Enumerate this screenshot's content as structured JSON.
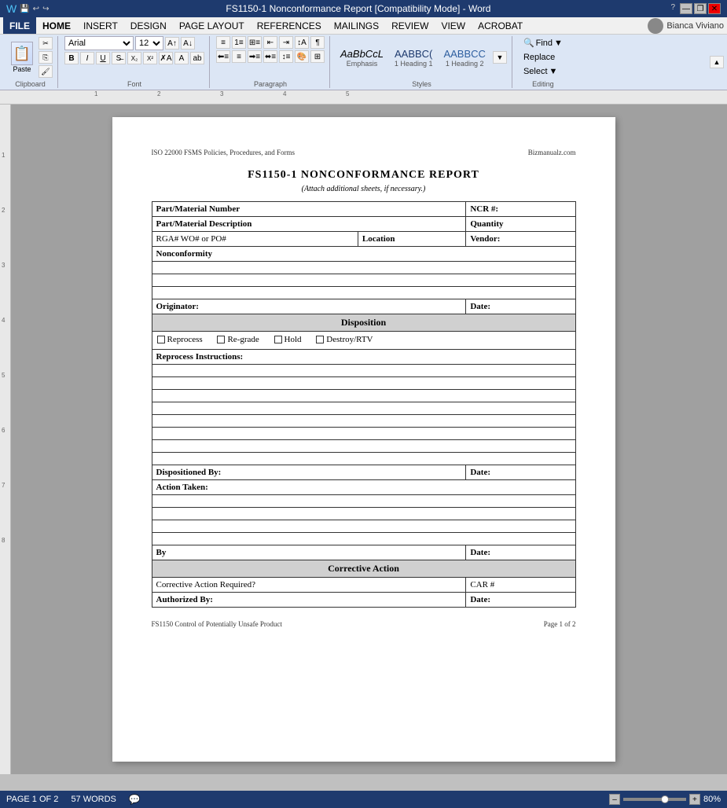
{
  "titleBar": {
    "title": "FS1150-1 Nonconformance Report [Compatibility Mode] - Word",
    "helpBtn": "?",
    "minimizeBtn": "—",
    "restoreBtn": "❐",
    "closeBtn": "✕"
  },
  "menuBar": {
    "fileLabel": "FILE",
    "tabs": [
      "HOME",
      "INSERT",
      "DESIGN",
      "PAGE LAYOUT",
      "REFERENCES",
      "MAILINGS",
      "REVIEW",
      "VIEW",
      "ACROBAT"
    ],
    "activeTab": "HOME",
    "user": "Bianca Viviano"
  },
  "ribbon": {
    "clipboard": {
      "label": "Clipboard",
      "pasteLabel": "Paste"
    },
    "font": {
      "label": "Font",
      "fontName": "Arial",
      "fontSize": "12",
      "boldLabel": "B",
      "italicLabel": "I",
      "underlineLabel": "U"
    },
    "paragraph": {
      "label": "Paragraph"
    },
    "styles": {
      "label": "Styles",
      "items": [
        {
          "sample": "AaBbCcL",
          "label": "Emphasis"
        },
        {
          "sample": "AABBC(",
          "label": "1 Heading 1"
        },
        {
          "sample": "AABBCC",
          "label": "1 Heading 2"
        }
      ]
    },
    "editing": {
      "label": "Editing",
      "findLabel": "Find",
      "replaceLabel": "Replace",
      "selectLabel": "Select"
    }
  },
  "ruler": {
    "marks": [
      "1",
      "2",
      "3",
      "4",
      "5"
    ]
  },
  "document": {
    "header": {
      "left": "ISO 22000 FSMS Policies, Procedures, and Forms",
      "right": "Bizmanualz.com"
    },
    "formTitle": "FS1150-1   NONCONFORMANCE REPORT",
    "formSubtitle": "(Attach additional sheets, if necessary.)",
    "table": {
      "rows": [
        {
          "type": "header-row",
          "col1": "Part/Material Number",
          "col2": "NCR #:"
        },
        {
          "type": "header-row",
          "col1": "Part/Material Description",
          "col2": "Quantity"
        },
        {
          "type": "data-row",
          "col1a": "RGA# WO# or PO#",
          "col1b": "Location",
          "col2": "Vendor:"
        },
        {
          "type": "full-row",
          "label": "Nonconformity"
        },
        {
          "type": "empty-row"
        },
        {
          "type": "empty-row"
        },
        {
          "type": "empty-row"
        },
        {
          "type": "sig-row",
          "col1": "Originator:",
          "col2": "Date:"
        },
        {
          "type": "section-header",
          "label": "Disposition"
        },
        {
          "type": "checkbox-row",
          "items": [
            "Reprocess",
            "Re-grade",
            "Hold",
            "Destroy/RTV"
          ]
        },
        {
          "type": "full-row",
          "label": "Reprocess Instructions:"
        },
        {
          "type": "empty-row"
        },
        {
          "type": "empty-row"
        },
        {
          "type": "empty-row"
        },
        {
          "type": "empty-row"
        },
        {
          "type": "empty-row"
        },
        {
          "type": "empty-row"
        },
        {
          "type": "empty-row"
        },
        {
          "type": "empty-row"
        },
        {
          "type": "sig-row",
          "col1": "Dispositioned By:",
          "col2": "Date:"
        },
        {
          "type": "full-row",
          "label": "Action Taken:"
        },
        {
          "type": "empty-row"
        },
        {
          "type": "empty-row"
        },
        {
          "type": "empty-row"
        },
        {
          "type": "empty-row"
        },
        {
          "type": "sig-row",
          "col1": "By",
          "col2": "Date:"
        },
        {
          "type": "section-header",
          "label": "Corrective Action"
        },
        {
          "type": "sig-row",
          "col1": "Corrective Action Required?",
          "col2": "CAR #"
        },
        {
          "type": "sig-row",
          "col1": "Authorized By:",
          "col2": "Date:"
        }
      ]
    },
    "footer": {
      "left": "FS1150 Control of Potentially Unsafe Product",
      "right": "Page 1 of 2"
    }
  },
  "statusBar": {
    "pageInfo": "PAGE 1 OF 2",
    "wordCount": "57 WORDS",
    "zoom": "80%"
  }
}
